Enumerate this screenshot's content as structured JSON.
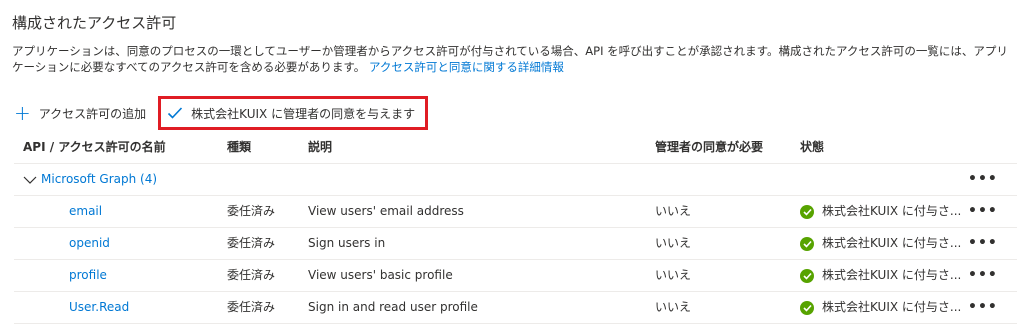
{
  "title": "構成されたアクセス許可",
  "description": {
    "text": "アプリケーションは、同意のプロセスの一環としてユーザーか管理者からアクセス許可が付与されている場合、API を呼び出すことが承認されます。構成されたアクセス許可の一覧には、アプリケーションに必要なすべてのアクセス許可を含める必要があります。",
    "link_text": "アクセス許可と同意に関する詳細情報"
  },
  "toolbar": {
    "add_label": "アクセス許可の追加",
    "consent_label": "株式会社KUIX に管理者の同意を与えます"
  },
  "table": {
    "headers": [
      "API / アクセス許可の名前",
      "種類",
      "説明",
      "管理者の同意が必要",
      "状態"
    ],
    "group": {
      "label": "Microsoft Graph (4)"
    },
    "rows": [
      {
        "name": "email",
        "type": "委任済み",
        "description": "View users' email address",
        "admin_consent": "いいえ",
        "status": "株式会社KUIX に付与さ..."
      },
      {
        "name": "openid",
        "type": "委任済み",
        "description": "Sign users in",
        "admin_consent": "いいえ",
        "status": "株式会社KUIX に付与さ..."
      },
      {
        "name": "profile",
        "type": "委任済み",
        "description": "View users' basic profile",
        "admin_consent": "いいえ",
        "status": "株式会社KUIX に付与さ..."
      },
      {
        "name": "User.Read",
        "type": "委任済み",
        "description": "Sign in and read user profile",
        "admin_consent": "いいえ",
        "status": "株式会社KUIX に付与さ..."
      }
    ],
    "more_label": "•••"
  },
  "colors": {
    "accent": "#0078d4",
    "highlight": "#e01c24",
    "success": "#57a300"
  }
}
